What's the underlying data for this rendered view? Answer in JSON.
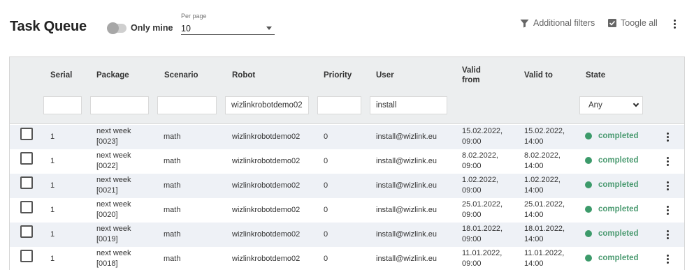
{
  "header": {
    "title": "Task Queue",
    "only_mine_label": "Only mine",
    "per_page_caption": "Per page",
    "per_page_value": "10",
    "filters_label": "Additional filters",
    "toggle_all_label": "Toogle all"
  },
  "table": {
    "columns": {
      "serial": "Serial",
      "package": "Package",
      "scenario": "Scenario",
      "robot": "Robot",
      "priority": "Priority",
      "user": "User",
      "valid_from_1": "Valid",
      "valid_from_2": "from",
      "valid_to": "Valid to",
      "state": "State"
    },
    "filters": {
      "robot": "wizlinkrobotdemo02",
      "user": "install",
      "state": "Any"
    },
    "rows": [
      {
        "serial": "1",
        "package_1": "next week",
        "package_2": "[0023]",
        "scenario": "math",
        "robot": "wizlinkrobotdemo02",
        "priority": "0",
        "user": "install@wizlink.eu",
        "from_1": "15.02.2022,",
        "from_2": "09:00",
        "to_1": "15.02.2022,",
        "to_2": "14:00",
        "state": "completed"
      },
      {
        "serial": "1",
        "package_1": "next week",
        "package_2": "[0022]",
        "scenario": "math",
        "robot": "wizlinkrobotdemo02",
        "priority": "0",
        "user": "install@wizlink.eu",
        "from_1": "8.02.2022,",
        "from_2": "09:00",
        "to_1": "8.02.2022,",
        "to_2": "14:00",
        "state": "completed"
      },
      {
        "serial": "1",
        "package_1": "next week",
        "package_2": "[0021]",
        "scenario": "math",
        "robot": "wizlinkrobotdemo02",
        "priority": "0",
        "user": "install@wizlink.eu",
        "from_1": "1.02.2022,",
        "from_2": "09:00",
        "to_1": "1.02.2022,",
        "to_2": "14:00",
        "state": "completed"
      },
      {
        "serial": "1",
        "package_1": "next week",
        "package_2": "[0020]",
        "scenario": "math",
        "robot": "wizlinkrobotdemo02",
        "priority": "0",
        "user": "install@wizlink.eu",
        "from_1": "25.01.2022,",
        "from_2": "09:00",
        "to_1": "25.01.2022,",
        "to_2": "14:00",
        "state": "completed"
      },
      {
        "serial": "1",
        "package_1": "next week",
        "package_2": "[0019]",
        "scenario": "math",
        "robot": "wizlinkrobotdemo02",
        "priority": "0",
        "user": "install@wizlink.eu",
        "from_1": "18.01.2022,",
        "from_2": "09:00",
        "to_1": "18.01.2022,",
        "to_2": "14:00",
        "state": "completed"
      },
      {
        "serial": "1",
        "package_1": "next week",
        "package_2": "[0018]",
        "scenario": "math",
        "robot": "wizlinkrobotdemo02",
        "priority": "0",
        "user": "install@wizlink.eu",
        "from_1": "11.01.2022,",
        "from_2": "09:00",
        "to_1": "11.01.2022,",
        "to_2": "14:00",
        "state": "completed"
      }
    ]
  },
  "colors": {
    "state_completed": "#3c9a6a",
    "header_bg": "#eceeef",
    "row_alt_bg": "#eef1f6"
  },
  "icons": {
    "filters": "filter-icon",
    "toggle_all": "checkbox-checked-icon",
    "menu": "kebab-menu-icon",
    "status": "status-dot-icon"
  }
}
